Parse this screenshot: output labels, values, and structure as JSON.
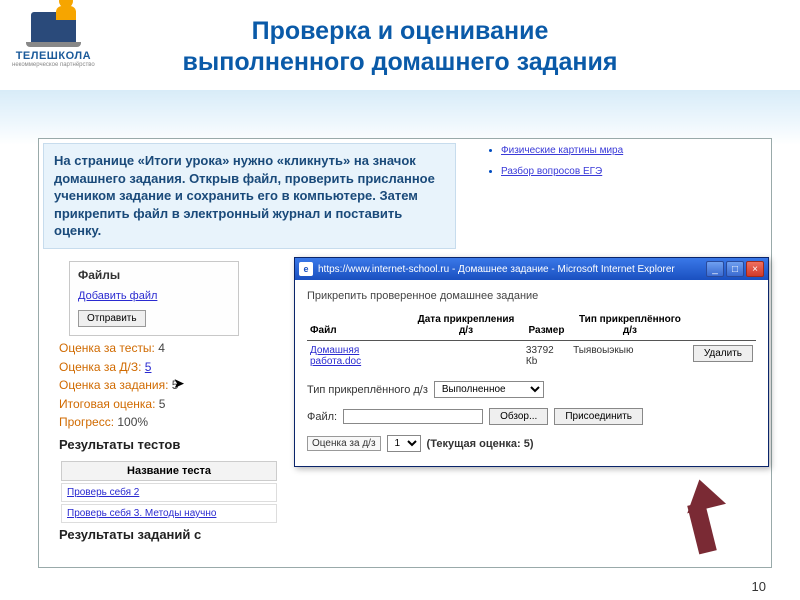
{
  "logo": {
    "brand": "ТЕЛЕШКОЛА",
    "tagline": "некоммерческое партнёрство"
  },
  "title_line1": "Проверка и оценивание",
  "title_line2": "выполненного домашнего задания",
  "callout_text": "На странице «Итоги урока» нужно «кликнуть» на значок домашнего задания. Открыв файл, проверить присланное учеником задание и сохранить его в компьютере. Затем прикрепить файл в электронный журнал и поставить оценку.",
  "right_links": [
    "Физические картины мира",
    "Разбор вопросов ЕГЭ"
  ],
  "files_block": {
    "heading": "Файлы",
    "add_link": "Добавить файл",
    "send_btn": "Отправить"
  },
  "grades": {
    "tests": {
      "label": "Оценка за тесты:",
      "value": "4"
    },
    "dz": {
      "label": "Оценка за Д/З:",
      "value": "5"
    },
    "tasks": {
      "label": "Оценка за задания:",
      "value": "5"
    },
    "final": {
      "label": "Итоговая оценка:",
      "value": "5"
    },
    "prog": {
      "label": "Прогресс:",
      "value": "100%"
    }
  },
  "tests_heading": "Результаты тестов",
  "tests_col": "Название теста",
  "tests_rows": [
    "Проверь себя 2",
    "Проверь себя 3. Методы научно"
  ],
  "tasks_heading": "Результаты заданий с",
  "ie": {
    "title": "https://www.internet-school.ru - Домашнее задание - Microsoft Internet Explorer",
    "caption": "Прикрепить проверенное домашнее задание",
    "cols": {
      "file": "Файл",
      "date": "Дата прикрепления д/з",
      "size": "Размер",
      "type": "Тип прикреплённого д/з"
    },
    "row": {
      "file": "Домашняя работа.doc",
      "date": "",
      "size": "33792 Кb",
      "type": "Тыявоыэкыю"
    },
    "delete_btn": "Удалить",
    "type_label": "Тип прикреплённого д/з",
    "type_value": "Выполненное",
    "file_label": "Файл:",
    "browse_btn": "Обзор...",
    "attach_btn": "Присоединить",
    "grade_box_label": "Оценка за д/з",
    "grade_value": "1",
    "current_grade": "(Текущая оценка: 5)"
  },
  "page_number": "10"
}
